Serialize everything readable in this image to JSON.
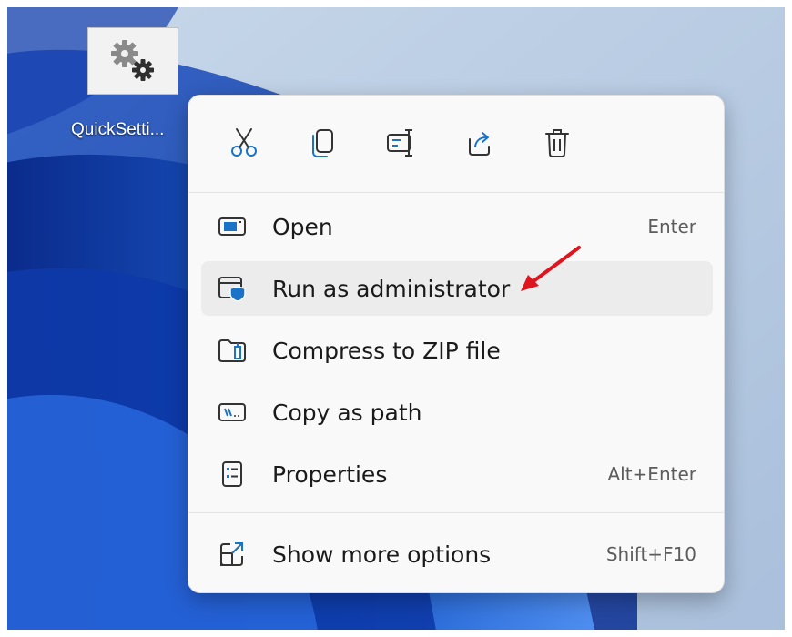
{
  "desktop": {
    "shortcut": {
      "label": "QuickSetti...",
      "icon": "gears-icon"
    }
  },
  "context_menu": {
    "toolbar": [
      {
        "name": "cut",
        "icon": "cut-icon"
      },
      {
        "name": "copy",
        "icon": "copy-icon"
      },
      {
        "name": "rename",
        "icon": "rename-icon"
      },
      {
        "name": "share",
        "icon": "share-icon"
      },
      {
        "name": "delete",
        "icon": "trash-icon"
      }
    ],
    "items": [
      {
        "label": "Open",
        "shortcut": "Enter",
        "icon": "open-window-icon"
      },
      {
        "label": "Run as administrator",
        "shortcut": "",
        "icon": "admin-shield-icon",
        "highlighted": true
      },
      {
        "label": "Compress to ZIP file",
        "shortcut": "",
        "icon": "zip-folder-icon"
      },
      {
        "label": "Copy as path",
        "shortcut": "",
        "icon": "copy-path-icon"
      },
      {
        "label": "Properties",
        "shortcut": "Alt+Enter",
        "icon": "properties-icon"
      },
      {
        "label": "Show more options",
        "shortcut": "Shift+F10",
        "icon": "more-options-icon"
      }
    ]
  },
  "colors": {
    "accent_blue": "#1a73c7",
    "annotation_arrow": "#e0141e",
    "menu_background": "#f9f9f9",
    "hover_background": "#ececec"
  },
  "annotation": {
    "type": "red-arrow",
    "target": "Run as administrator"
  }
}
